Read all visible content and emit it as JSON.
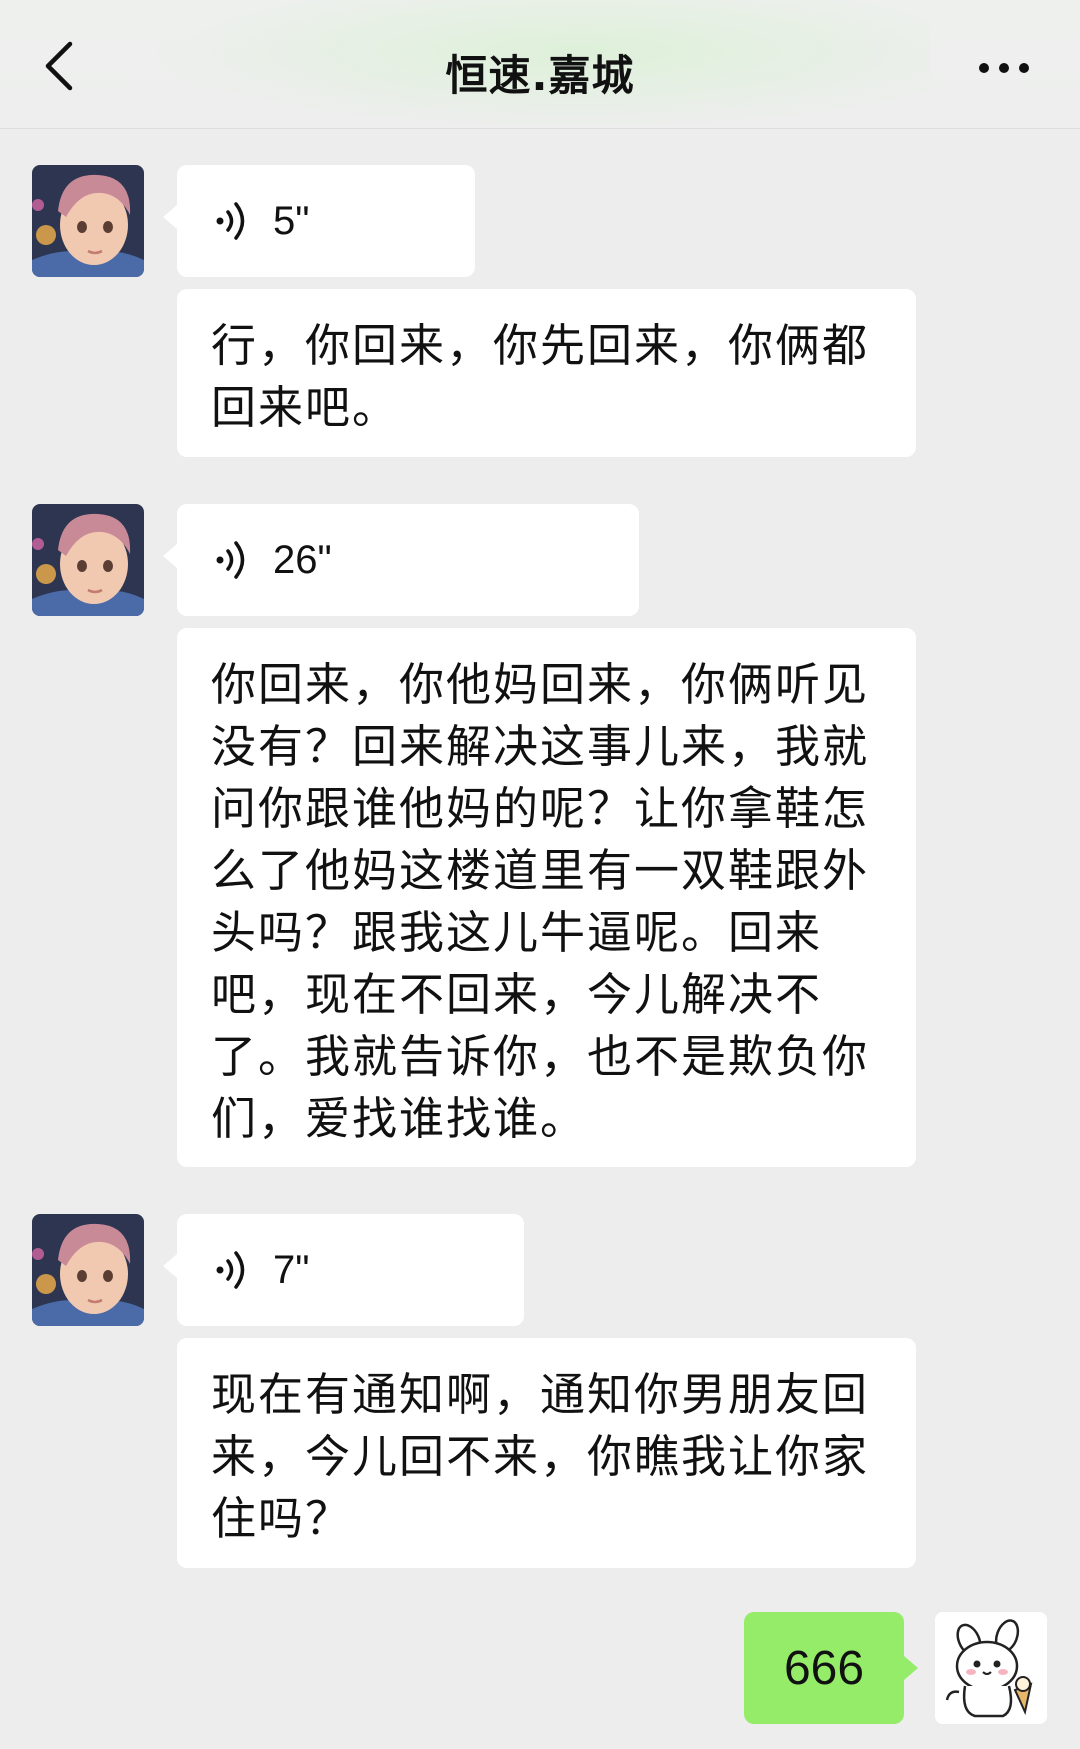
{
  "header": {
    "title": "恒速.嘉城"
  },
  "messages": [
    {
      "sender": "other",
      "type": "voice",
      "duration": "5\""
    },
    {
      "sender": "other",
      "type": "text",
      "text": "行，你回来，你先回来，你俩都回来吧。"
    },
    {
      "sender": "other",
      "type": "voice",
      "duration": "26\""
    },
    {
      "sender": "other",
      "type": "text",
      "text": "你回来，你他妈回来，你俩听见没有？回来解决这事儿来，我就问你跟谁他妈的呢？让你拿鞋怎么了他妈这楼道里有一双鞋跟外头吗？跟我这儿牛逼呢。回来吧，现在不回来，今儿解决不了。我就告诉你，也不是欺负你们，爱找谁找谁。"
    },
    {
      "sender": "other",
      "type": "voice",
      "duration": "7\""
    },
    {
      "sender": "other",
      "type": "text",
      "text": "现在有通知啊，通知你男朋友回来，今儿回不来，你瞧我让你家住吗？"
    },
    {
      "sender": "me",
      "type": "text",
      "text": "666"
    }
  ],
  "icons": {
    "back": "chevron-left-icon",
    "more": "more-dots-icon",
    "voice": "voice-wave-icon"
  },
  "colors": {
    "background": "#ededed",
    "bubble_other": "#ffffff",
    "bubble_me": "#95ec69"
  }
}
